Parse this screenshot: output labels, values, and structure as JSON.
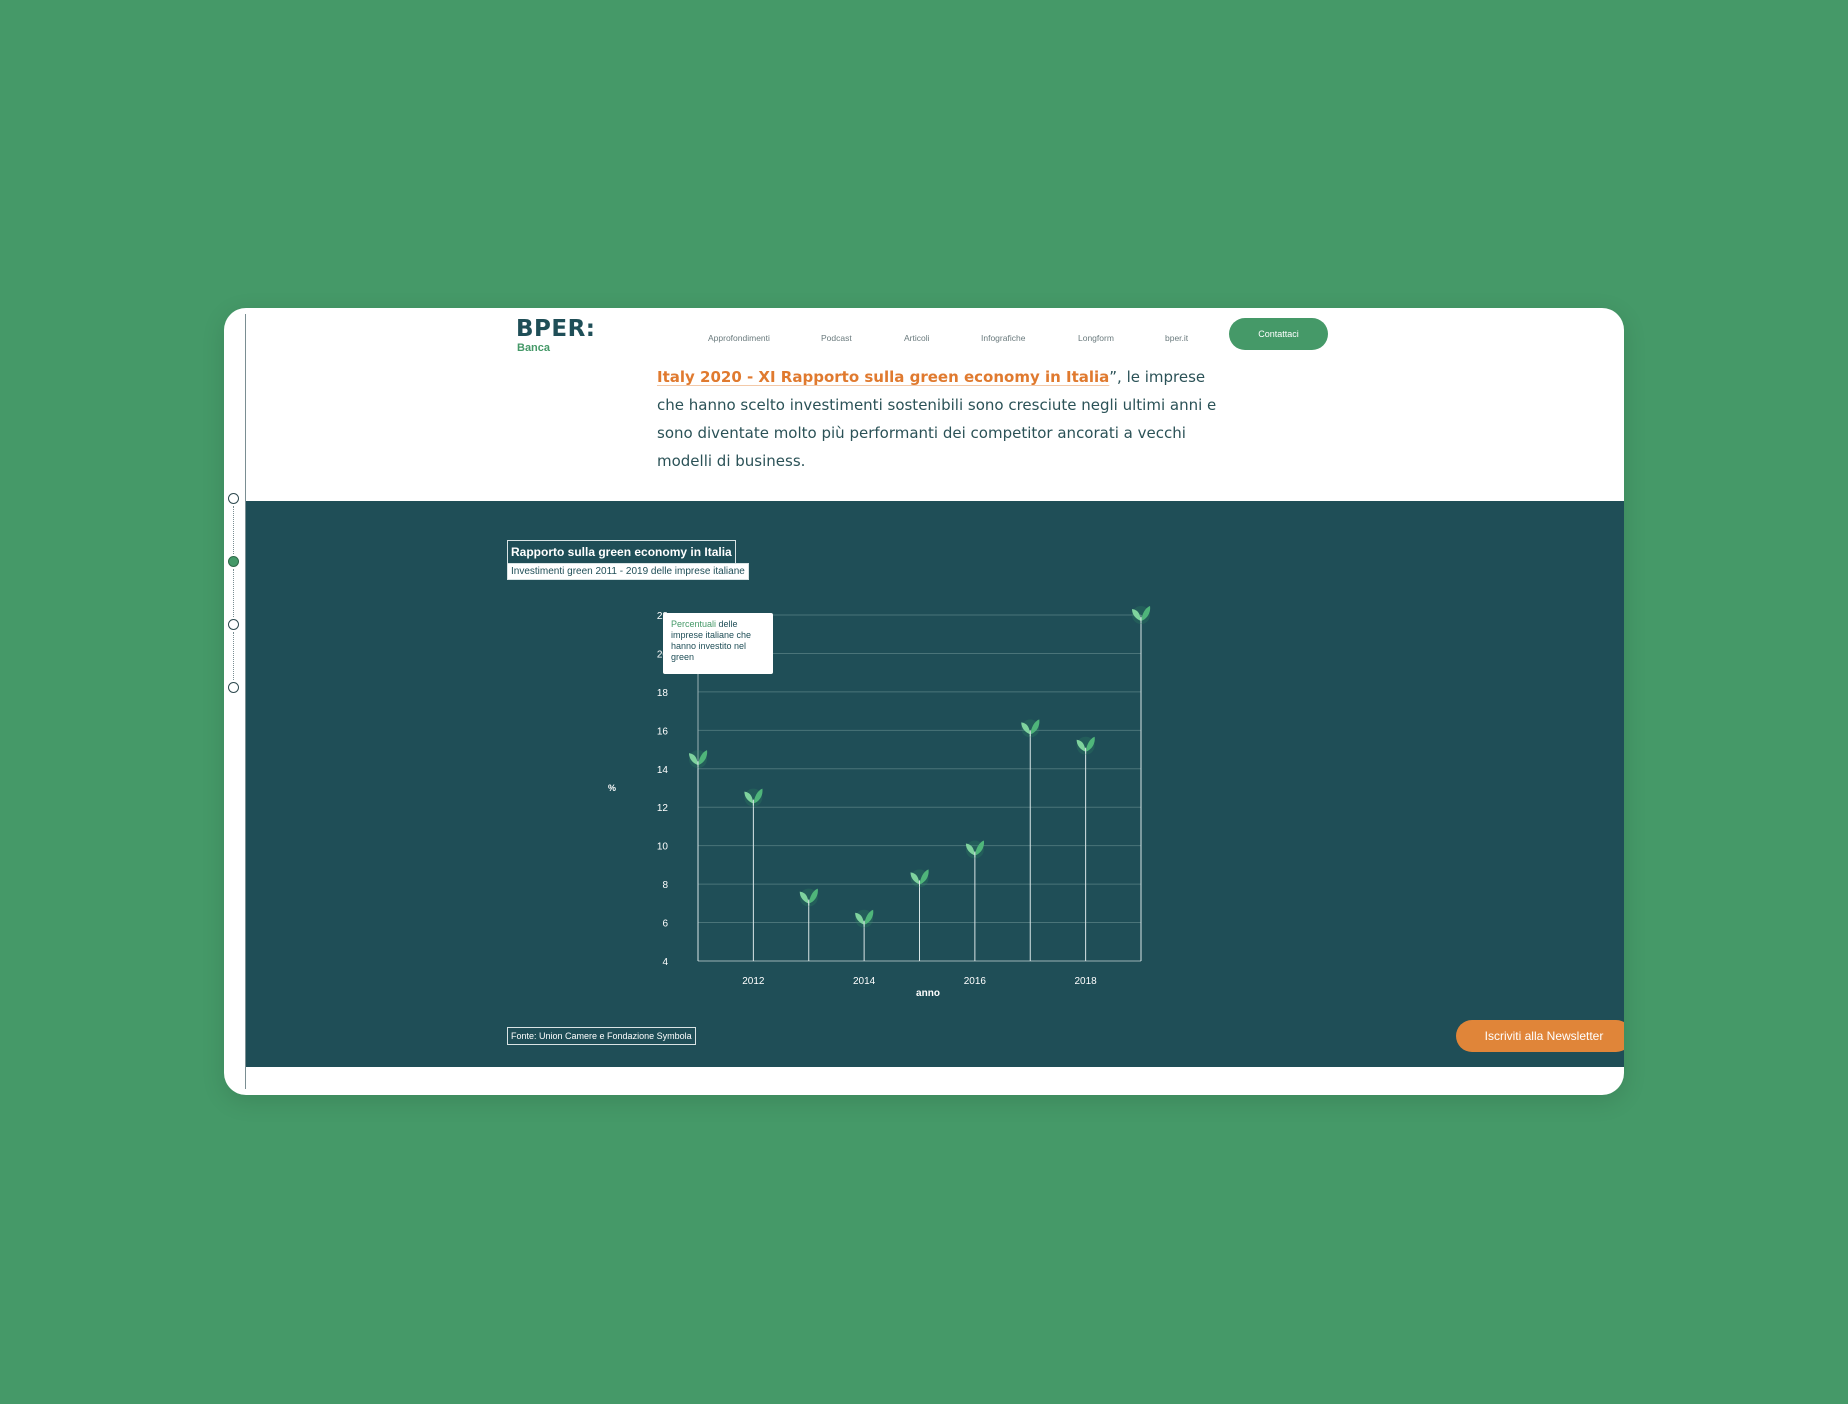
{
  "header": {
    "logo_main": "BPER:",
    "logo_sub": "Banca",
    "nav": [
      "Approfondimenti",
      "Podcast",
      "Articoli",
      "Infografiche",
      "Longform",
      "bper.it"
    ],
    "contact_label": "Contattaci"
  },
  "intro": {
    "link_text": "Italy 2020 - XI Rapporto sulla green economy in Italia",
    "text_after_link": "”, le imprese che hanno scelto investimenti sostenibili sono cresciute negli ultimi anni e sono diventate molto più performanti dei competitor ancorati a vecchi modelli di business."
  },
  "chart_section": {
    "title": "Rapporto sulla green economy in Italia",
    "subtitle": "Investimenti green 2011 - 2019 delle imprese italiane",
    "legend_highlight": "Percentuali",
    "legend_rest": " delle imprese italiane che hanno investito nel green",
    "source": "Fonte: Union Camere e Fondazione Symbola",
    "newsletter_label": "Iscriviti alla Newsletter"
  },
  "colors": {
    "brand_green": "#459968",
    "dark_teal": "#1f4e57",
    "accent_orange": "#e08539"
  },
  "chart_data": {
    "type": "bar",
    "title": "Rapporto sulla green economy in Italia",
    "subtitle": "Investimenti green 2011 - 2019 delle imprese italiane",
    "xlabel": "anno",
    "ylabel": "%",
    "x": [
      2011,
      2012,
      2013,
      2014,
      2015,
      2016,
      2017,
      2018,
      2019
    ],
    "values": [
      14.5,
      12.5,
      7.3,
      6.2,
      8.3,
      9.8,
      16.1,
      15.2,
      22.0
    ],
    "x_tick_labels": [
      "2012",
      "2014",
      "2016",
      "2018"
    ],
    "y_ticks": [
      4,
      6,
      8,
      10,
      12,
      14,
      16,
      18,
      20,
      22
    ],
    "ylim": [
      4,
      22
    ],
    "grid": true,
    "marker": "leaf-icon"
  }
}
